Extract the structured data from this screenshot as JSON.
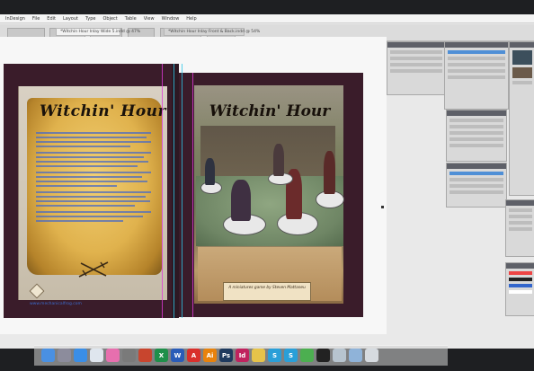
{
  "menu": [
    "InDesign",
    "File",
    "Edit",
    "Layout",
    "Type",
    "Object",
    "Table",
    "View",
    "Window",
    "Help"
  ],
  "tabs": [
    "*Witchin Hour Inlay Wide 5.indd @ 47%",
    "*Witchin Hour Inlay Front & Back.indd @ 54%"
  ],
  "document": {
    "back_title": "Witchin' Hour",
    "front_title": "Witchin' Hour",
    "credit": "A miniatures game by Steven Mattaneu",
    "url": "www.mechanicalfrog.com"
  },
  "colors": {
    "bleed": "#3a1c2a",
    "parchment": "#e0b24d",
    "body_text": "#4e6cc0",
    "guide_magenta": "#e03ad8",
    "guide_cyan": "#2ec7e6"
  },
  "dock_icons": [
    "finder-icon",
    "launchpad-icon",
    "safari-icon",
    "mail-icon",
    "itunes-icon",
    "excel-icon",
    "word-icon",
    "acrobat-icon",
    "illustrator-icon",
    "photoshop-icon",
    "indesign-icon",
    "chrome-icon",
    "skype-icon",
    "skype2-icon",
    "facetime-icon",
    "terminal-icon",
    "preview-icon",
    "folder-icon",
    "trash-icon"
  ]
}
